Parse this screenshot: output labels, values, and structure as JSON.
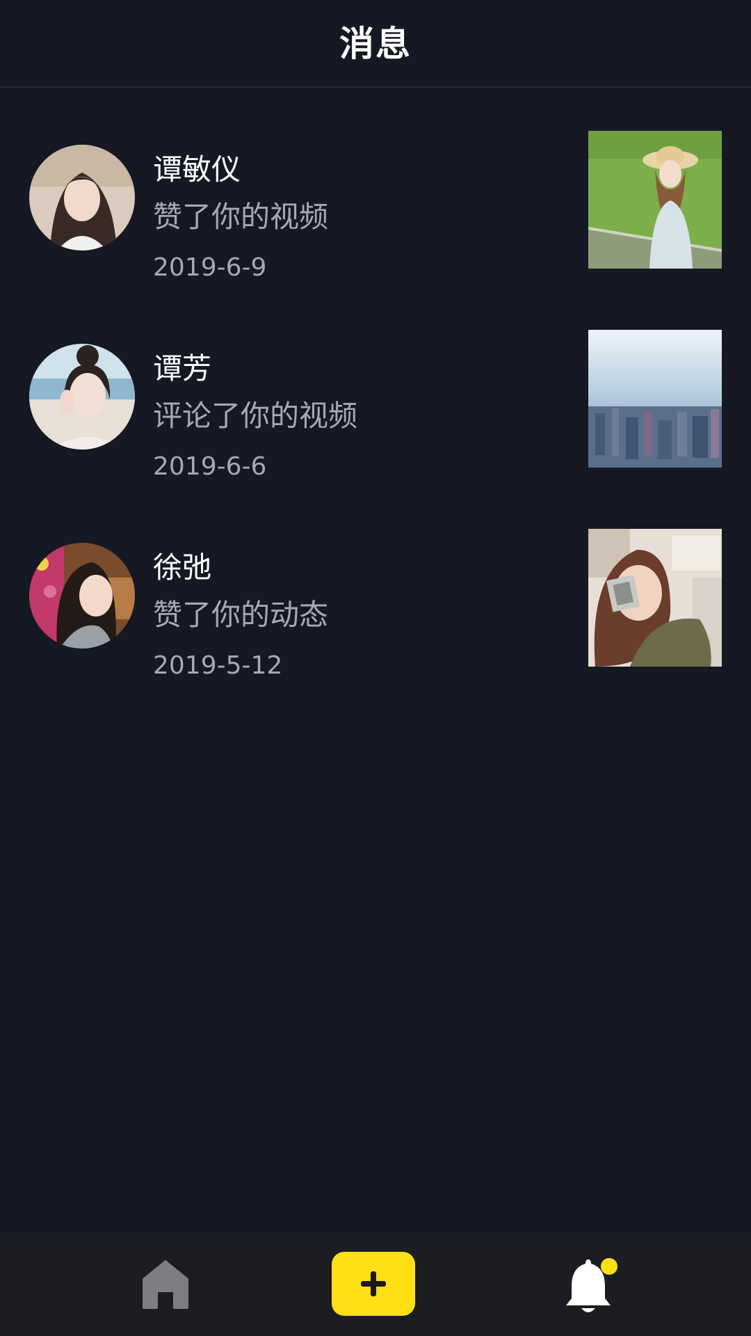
{
  "header": {
    "title": "消息"
  },
  "messages": [
    {
      "name": "谭敏仪",
      "action": "赞了你的视频",
      "date": "2019-6-9"
    },
    {
      "name": "谭芳",
      "action": "评论了你的视频",
      "date": "2019-6-6"
    },
    {
      "name": "徐弛",
      "action": "赞了你的动态",
      "date": "2019-5-12"
    }
  ],
  "tabbar": {
    "items": [
      {
        "icon": "home-icon",
        "active": false
      },
      {
        "icon": "plus-icon",
        "active": false
      },
      {
        "icon": "bell-icon",
        "active": true,
        "has_badge": true
      }
    ]
  },
  "colors": {
    "background": "#161824",
    "tabbar_background": "#1c1d22",
    "accent": "#ffe015",
    "secondary_text": "#a7a9b2",
    "inactive_icon": "#7d7e83"
  }
}
